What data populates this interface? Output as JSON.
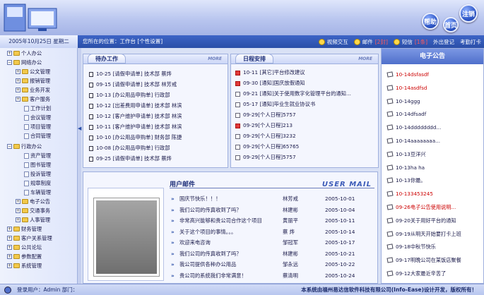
{
  "header": {
    "help_label": "帮助",
    "home_label": "首页",
    "logout_label": "注销"
  },
  "nav": {
    "date": "2005年10月25日  星期二",
    "location": "您所在的位置：工作台 [个性设置]",
    "toolbar": [
      {
        "label": "视频交互",
        "count": ""
      },
      {
        "label": "邮件",
        "count": "[2封]"
      },
      {
        "label": "短信",
        "count": "[1条]"
      },
      {
        "label": "外出登记",
        "count": ""
      },
      {
        "label": "考勤打卡",
        "count": ""
      }
    ]
  },
  "sidebar": {
    "items": [
      {
        "label": "个人办公",
        "level": 0,
        "type": "folder",
        "box": "+"
      },
      {
        "label": "网络办公",
        "level": 0,
        "type": "folder",
        "box": "−"
      },
      {
        "label": "公文管理",
        "level": 1,
        "type": "folder",
        "box": "+"
      },
      {
        "label": "报销管理",
        "level": 1,
        "type": "folder",
        "box": "+"
      },
      {
        "label": "业务开发",
        "level": 1,
        "type": "folder",
        "box": "+"
      },
      {
        "label": "客户服务",
        "level": 1,
        "type": "folder",
        "box": "+"
      },
      {
        "label": "工作计划",
        "level": 2,
        "type": "doc",
        "box": ""
      },
      {
        "label": "会议管理",
        "level": 2,
        "type": "doc",
        "box": ""
      },
      {
        "label": "项目管理",
        "level": 2,
        "type": "doc",
        "box": ""
      },
      {
        "label": "合同管理",
        "level": 2,
        "type": "doc",
        "box": ""
      },
      {
        "label": "行政办公",
        "level": 0,
        "type": "folder",
        "box": "−"
      },
      {
        "label": "资产管理",
        "level": 2,
        "type": "doc",
        "box": ""
      },
      {
        "label": "图书管理",
        "level": 2,
        "type": "doc",
        "box": ""
      },
      {
        "label": "投诉管理",
        "level": 2,
        "type": "doc",
        "box": ""
      },
      {
        "label": "规章制度",
        "level": 2,
        "type": "doc",
        "box": ""
      },
      {
        "label": "车辆管理",
        "level": 2,
        "type": "doc",
        "box": ""
      },
      {
        "label": "电子公告",
        "level": 1,
        "type": "folder",
        "box": "+"
      },
      {
        "label": "交通事务",
        "level": 1,
        "type": "folder",
        "box": "+"
      },
      {
        "label": "人事管理",
        "level": 1,
        "type": "folder",
        "box": "+"
      },
      {
        "label": "财务管理",
        "level": 0,
        "type": "folder",
        "box": "+"
      },
      {
        "label": "客户关系管理",
        "level": 0,
        "type": "folder",
        "box": "+"
      },
      {
        "label": "公共论坛",
        "level": 0,
        "type": "folder",
        "box": "+"
      },
      {
        "label": "参数配置",
        "level": 0,
        "type": "folder",
        "box": "+"
      },
      {
        "label": "系统管理",
        "level": 0,
        "type": "folder",
        "box": "+"
      }
    ]
  },
  "todo": {
    "title": "待办工作",
    "more": "MORE",
    "items": [
      "10-25 [请假申请单] 技术部 蔡烨",
      "09-15 [请假申请单] 技术部 林芳戒",
      "10-13 [办公用品申购单] 行政部",
      "10-12 [出差费用申请单] 技术部 林滨",
      "10-12 [客户维护申请单] 技术部 林滨",
      "10-11 [客户维护申请单] 技术部 林滨",
      "10-10 [办公用品申购单] 财务部 陈捷",
      "10-08 [办公用品申购单] 行政部",
      "09-25 [请假申请单] 技术部 蔡烨"
    ]
  },
  "schedule": {
    "title": "日程安排",
    "more": "MORE",
    "items": [
      {
        "text": "10-11 [其它]平台修改建议",
        "icon": "red"
      },
      {
        "text": "09-30 [通知]国庆放假通知",
        "icon": "red"
      },
      {
        "text": "09-21 [通知]关于使用数字化管理平台的通知...",
        "icon": "check"
      },
      {
        "text": "05-17 [通知]毕业生就业协议书",
        "icon": "check"
      },
      {
        "text": "09-29[个人日程]5757",
        "icon": "check"
      },
      {
        "text": "09-29[个人日程]213",
        "icon": "red"
      },
      {
        "text": "09-29[个人日程]3232",
        "icon": "check"
      },
      {
        "text": "09-29[个人日程]65765",
        "icon": "check"
      },
      {
        "text": "09-29[个人日程]5757",
        "icon": "check"
      }
    ]
  },
  "announcements": {
    "title": "电子公告",
    "items": [
      {
        "text": "10-14dsfasdf",
        "color": "#cc0000"
      },
      {
        "text": "10-14asdfsd",
        "color": "#cc0000"
      },
      {
        "text": "10-14ggg",
        "color": "#1a1a4a"
      },
      {
        "text": "10-14dfsadf",
        "color": "#1a1a4a"
      },
      {
        "text": "10-14dddddddd...",
        "color": "#1a1a4a"
      },
      {
        "text": "10-14aaaaaaaa...",
        "color": "#1a1a4a"
      },
      {
        "text": "10-13豆洋兴",
        "color": "#1a1a4a"
      },
      {
        "text": "10-13ha ha",
        "color": "#1a1a4a"
      },
      {
        "text": "10-13你最。",
        "color": "#1a1a4a"
      },
      {
        "text": "10-133453245",
        "color": "#cc0000"
      },
      {
        "text": "09-26电子公告使用说明...",
        "color": "#cc0000"
      },
      {
        "text": "09-20关于用好平台的通知",
        "color": "#1a1a4a"
      },
      {
        "text": "09-19从明天开始要打卡上班",
        "color": "#1a1a4a"
      },
      {
        "text": "09-18中秋节快乐",
        "color": "#1a1a4a"
      },
      {
        "text": "09-17明晚公司在某饭店聚餐",
        "color": "#1a1a4a"
      },
      {
        "text": "09-12大家最近辛苦了",
        "color": "#1a1a4a"
      }
    ]
  },
  "mail": {
    "title": "用户邮件",
    "title_en": "USER MAIL",
    "rows": [
      {
        "subject": "国庆节快乐！！！",
        "sender": "林芳戒",
        "date": "2005-10-01"
      },
      {
        "subject": "我们公司的传真收到了吗？",
        "sender": "林建彬",
        "date": "2005-10-04"
      },
      {
        "subject": "非常高兴能够和贵公司合作这个项目",
        "sender": "黄丽平",
        "date": "2005-10-11"
      },
      {
        "subject": "关于这个项目的事情。。。",
        "sender": "蔡   烨",
        "date": "2005-10-14"
      },
      {
        "subject": "欢迎来电咨询",
        "sender": "邹冠军",
        "date": "2005-10-17"
      },
      {
        "subject": "我们公司的传真收到了吗？",
        "sender": "林建彬",
        "date": "2005-10-21"
      },
      {
        "subject": "我公司提供各种办公用品",
        "sender": "邹永远",
        "date": "2005-10-22"
      },
      {
        "subject": "贵公司的系统我们非常满意！",
        "sender": "蔡清明",
        "date": "2005-10-24"
      }
    ]
  },
  "status": {
    "user": "登录用户：Admin  部门：",
    "copyright": "本系统由福州易达信软件科技有限公司(Info-Ease)设计开发，版权所有！"
  },
  "colors": {
    "accent": "#2b4fa8",
    "header_bg": "#b9c6ef",
    "alert_red": "#cc0000"
  }
}
